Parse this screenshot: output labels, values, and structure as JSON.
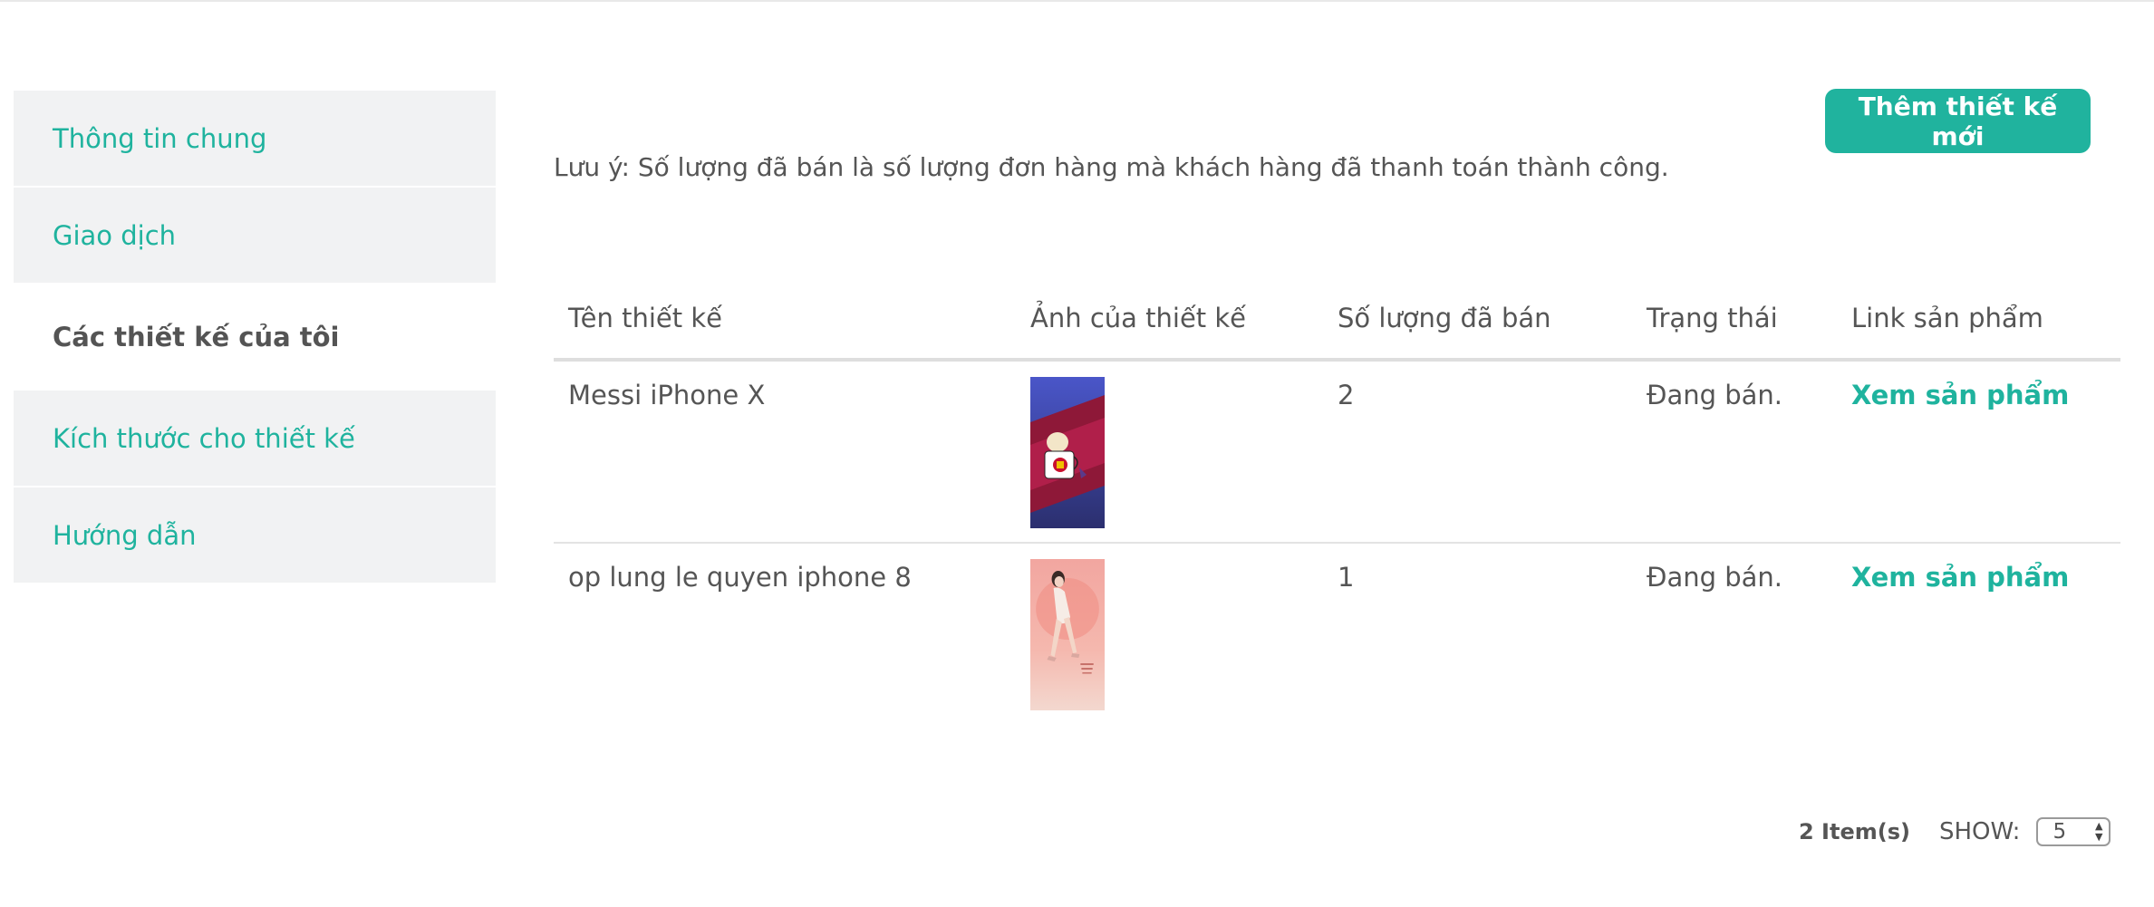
{
  "sidebar": {
    "items": [
      {
        "label": "Thông tin chung"
      },
      {
        "label": "Giao dịch"
      },
      {
        "label": "Các thiết kế của tôi"
      },
      {
        "label": "Kích thước cho thiết kế"
      },
      {
        "label": "Hướng dẫn"
      }
    ],
    "active_index": 2
  },
  "main": {
    "add_button_label": "Thêm thiết kế mới",
    "note": "Lưu ý: Số lượng đã bán là số lượng đơn hàng mà khách hàng đã thanh toán thành công.",
    "table": {
      "headers": [
        "Tên thiết kế",
        "Ảnh của thiết kế",
        "Số lượng đã bán",
        "Trạng thái",
        "Link sản phẩm"
      ],
      "rows": [
        {
          "name": "Messi iPhone X",
          "image": "messi-design-thumbnail",
          "sold": "2",
          "status": "Đang bán.",
          "link": "Xem sản phẩm"
        },
        {
          "name": "op lung le quyen iphone 8",
          "image": "le-quyen-design-thumbnail",
          "sold": "1",
          "status": "Đang bán.",
          "link": "Xem sản phẩm"
        }
      ]
    }
  },
  "footer": {
    "items_count": "2 Item(s)",
    "show_label": "SHOW:",
    "show_value": "5"
  },
  "colors": {
    "accent": "#1fb39e",
    "sidebar_bg": "#f1f2f3",
    "text": "#555555"
  }
}
